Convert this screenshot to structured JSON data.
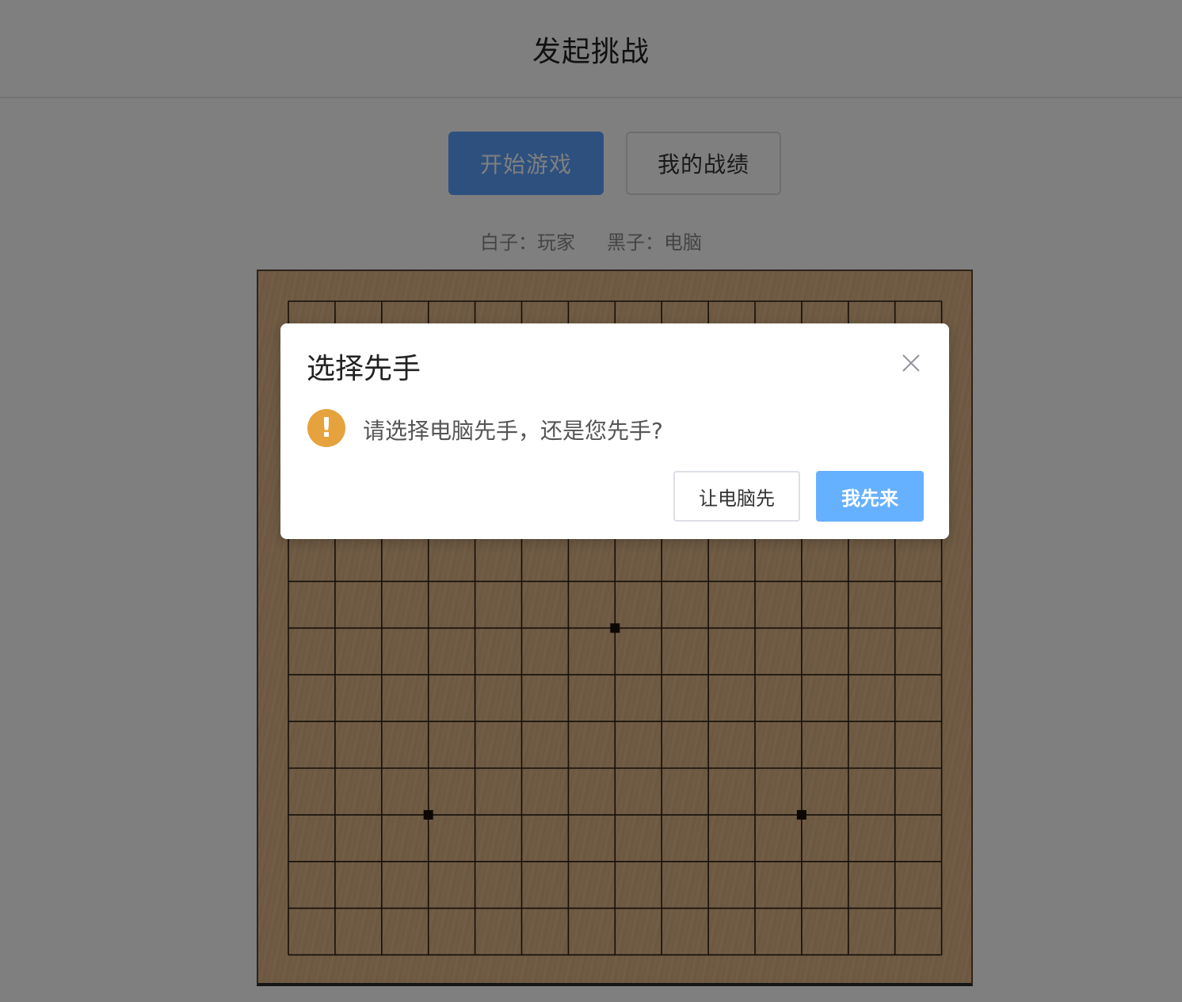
{
  "header": {
    "title": "发起挑战"
  },
  "toolbar": {
    "start_label": "开始游戏",
    "record_label": "我的战绩"
  },
  "players": {
    "white": "白子：玩家",
    "black": "黑子：电脑"
  },
  "board": {
    "grid_lines": 15,
    "star_points": [
      [
        7,
        7
      ],
      [
        3,
        11
      ],
      [
        11,
        11
      ]
    ]
  },
  "dialog": {
    "title": "选择先手",
    "message": "请选择电脑先手，还是您先手?",
    "icon": "warning-icon",
    "computer_first_label": "让电脑先",
    "me_first_label": "我先来",
    "accent_color": "#66b1ff",
    "warning_color": "#e6a23c"
  }
}
